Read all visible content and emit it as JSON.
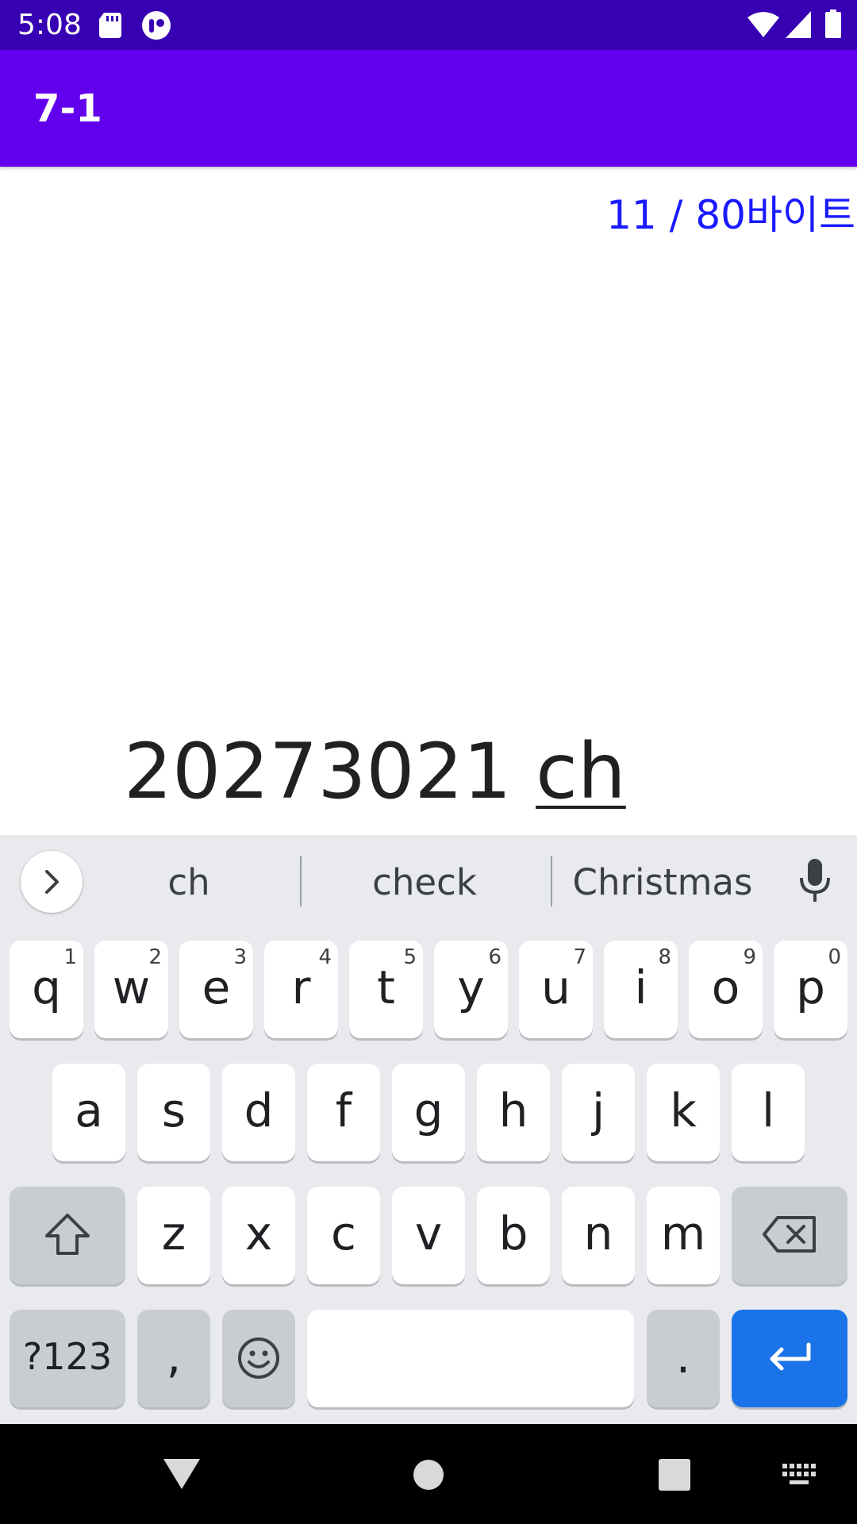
{
  "status_bar": {
    "time": "5:08",
    "icons": [
      "sd-card-icon",
      "app-notification-icon",
      "wifi-icon",
      "signal-icon",
      "battery-icon"
    ],
    "background": "#3700b3"
  },
  "app_bar": {
    "title": "7-1",
    "background": "#6200ee"
  },
  "content": {
    "byte_counter": "11 / 80바이트",
    "input_committed": "20273021 ",
    "input_composing": "ch"
  },
  "keyboard": {
    "suggestions": [
      "ch",
      "check",
      "Christmas"
    ],
    "row1": [
      {
        "key": "q",
        "hint": "1"
      },
      {
        "key": "w",
        "hint": "2"
      },
      {
        "key": "e",
        "hint": "3"
      },
      {
        "key": "r",
        "hint": "4"
      },
      {
        "key": "t",
        "hint": "5"
      },
      {
        "key": "y",
        "hint": "6"
      },
      {
        "key": "u",
        "hint": "7"
      },
      {
        "key": "i",
        "hint": "8"
      },
      {
        "key": "o",
        "hint": "9"
      },
      {
        "key": "p",
        "hint": "0"
      }
    ],
    "row2": [
      "a",
      "s",
      "d",
      "f",
      "g",
      "h",
      "j",
      "k",
      "l"
    ],
    "row3": [
      "z",
      "x",
      "c",
      "v",
      "b",
      "n",
      "m"
    ],
    "symbols_label": "?123",
    "comma_label": ",",
    "period_label": ".",
    "accent": "#1a73e8"
  },
  "nav_bar": {
    "icons": [
      "back-icon",
      "home-icon",
      "recents-icon",
      "keyboard-switch-icon"
    ]
  }
}
